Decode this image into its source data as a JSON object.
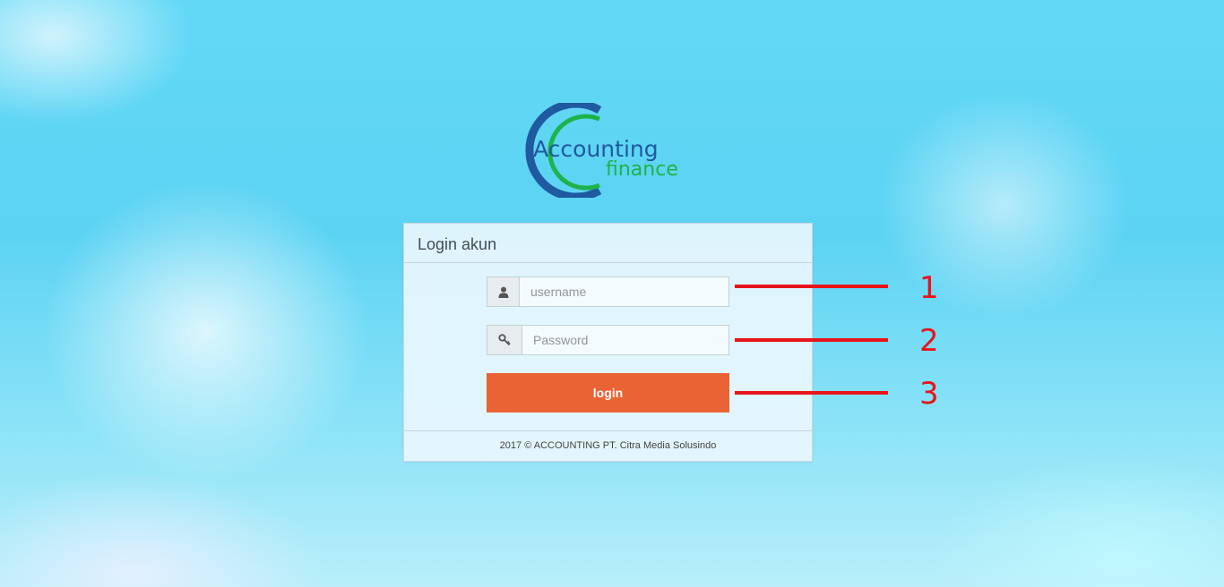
{
  "logo": {
    "line1": "Accounting",
    "line2": "finance",
    "colors": {
      "primary": "#1f5aa0",
      "accent": "#1db34a"
    }
  },
  "panel": {
    "title": "Login akun",
    "username": {
      "placeholder": "username",
      "value": "",
      "icon": "user-icon"
    },
    "password": {
      "placeholder": "Password",
      "value": "",
      "icon": "key-icon"
    },
    "login_label": "login",
    "footer": "2017 © ACCOUNTING PT. Citra Media Solusindo"
  },
  "annotations": {
    "color": "#e8141a",
    "labels": [
      "1",
      "2",
      "3"
    ]
  },
  "colors": {
    "button": "#e96334",
    "background": "#5cd3f3"
  }
}
